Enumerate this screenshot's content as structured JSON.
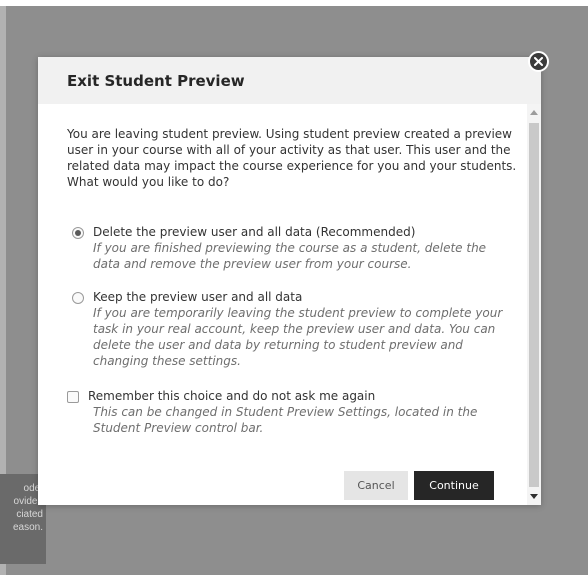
{
  "background": {
    "fragment_lines": [
      "ode,",
      "ovided",
      "ciated",
      "eason."
    ]
  },
  "dialog": {
    "title": "Exit Student Preview",
    "intro": "You are leaving student preview. Using student preview created a preview user in your course with all of your activity as that user. This user and the related data may impact the course experience for you and your students. What would you like to do?",
    "options": [
      {
        "label": "Delete the preview user and all data (Recommended)",
        "help": "If you are finished previewing the course as a student, delete the data and remove the preview user from your course.",
        "selected": true
      },
      {
        "label": "Keep the preview user and all data",
        "help": "If you are temporarily leaving the student preview to complete your task in your real account, keep the preview user and data. You can delete the user and data by returning to student preview and changing these settings.",
        "selected": false
      }
    ],
    "remember": {
      "label": "Remember this choice and do not ask me again",
      "help": "This can be changed in Student Preview Settings, located in the Student Preview control bar.",
      "checked": false
    },
    "buttons": {
      "cancel": "Cancel",
      "continue": "Continue"
    }
  },
  "icons": {
    "close": "close-icon"
  },
  "colors": {
    "overlay": "#8e8e8e",
    "header": "#f1f1f1",
    "primary_button": "#262626",
    "secondary_button": "#e5e5e5"
  }
}
